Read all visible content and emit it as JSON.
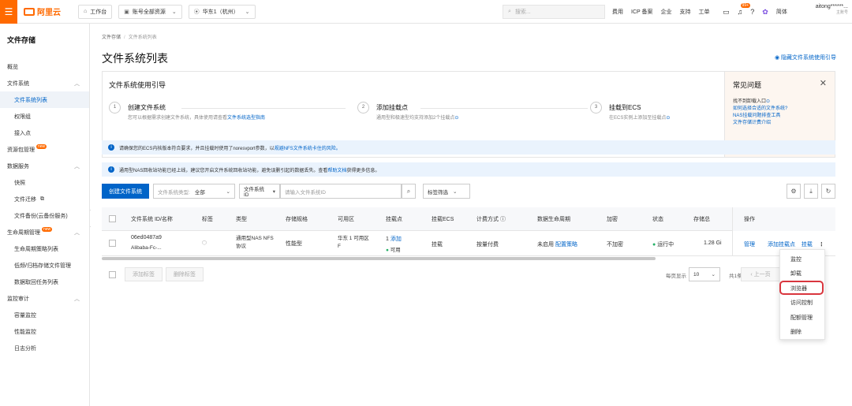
{
  "topbar": {
    "logo": "阿里云",
    "workbench": "工作台",
    "account": "账号全部资源",
    "region": "华东1（杭州）",
    "search_placeholder": "搜索...",
    "links": [
      "费用",
      "ICP 备案",
      "企业",
      "支持",
      "工单"
    ],
    "badge": "99+",
    "lang": "简体",
    "user_name": "aitong******...",
    "user_role": "主账号"
  },
  "sidebar": {
    "title": "文件存储",
    "items": [
      {
        "label": "概览"
      },
      {
        "label": "文件系统"
      },
      {
        "label": "文件系统列表"
      },
      {
        "label": "权限组"
      },
      {
        "label": "接入点"
      },
      {
        "label": "资源包管理",
        "badge": "new"
      },
      {
        "label": "数据服务"
      },
      {
        "label": "快照"
      },
      {
        "label": "文件迁移"
      },
      {
        "label": "文件备份(云备份服务)"
      },
      {
        "label": "生命周期管理",
        "badge": "new"
      },
      {
        "label": "生命周期策略列表"
      },
      {
        "label": "低频/归档存储文件管理"
      },
      {
        "label": "数据取回任务列表"
      },
      {
        "label": "监控审计"
      },
      {
        "label": "容量监控"
      },
      {
        "label": "性能监控"
      },
      {
        "label": "日志分析"
      }
    ]
  },
  "breadcrumb": {
    "root": "文件存储",
    "current": "文件系统列表"
  },
  "page_title": "文件系统列表",
  "hide_guide": "隐藏文件系统使用引导",
  "guide": {
    "title": "文件系统使用引导",
    "steps": [
      {
        "num": "1",
        "title": "创建文件系统",
        "desc": "您可以根据需求创建文件系统，具体使用请查看",
        "link": "文件系统选型指南"
      },
      {
        "num": "2",
        "title": "添加挂载点",
        "desc": "通用型和极速型均支持添加2个挂载点"
      },
      {
        "num": "3",
        "title": "挂载到ECS",
        "desc": "在ECS实例上添加至挂载点"
      }
    ],
    "faq_title": "常见问题",
    "faq": [
      "找不到卸载入口",
      "如何选择合适的文件系统?",
      "NAS挂载问题排查工具",
      "文件存储计费介绍"
    ]
  },
  "notices": [
    {
      "text": "请确保您的ECS内核版本符合要求，并且挂载时使用了noresvport参数，以",
      "link": "规避NFS文件系统卡住的风险。"
    },
    {
      "text": "通用型NAS回收站功能已经上线，建议您开启文件系统回收站功能，避免误删引起的数据丢失。查看",
      "link": "帮助文档",
      "tail": "获得更多信息。"
    }
  ],
  "toolbar": {
    "create_button": "创建文件系统",
    "type_label": "文件系统类型:",
    "type_value": "全部",
    "id_select": "文件系统ID",
    "search_placeholder": "请输入文件系统ID",
    "tag_filter": "标签筛选"
  },
  "table": {
    "headers": [
      "文件系统 ID/名称",
      "标签",
      "类型",
      "存储规格",
      "可用区",
      "挂载点",
      "挂载ECS",
      "计费方式",
      "数据生命周期",
      "加密",
      "状态",
      "存储总",
      "操作"
    ],
    "row": {
      "id": "06ed0487a9",
      "name": "Alibaba-Fc-...",
      "type": "通用型NAS NFS 协议",
      "spec": "性能型",
      "zone": "华东 1 可用区 F",
      "mount_count": "1",
      "mount_add": "添加",
      "mount_status": "可用",
      "mount_ecs": "挂载",
      "billing": "按量付费",
      "lifecycle": "未启用",
      "lifecycle_link": "配置策略",
      "encrypt": "不加密",
      "status": "运行中",
      "storage": "1.28 Gi",
      "ops": [
        "管理",
        "添加挂载点",
        "挂载"
      ]
    }
  },
  "footer": {
    "add_tag": "添加标签",
    "del_tag": "删除标签",
    "per_page_label": "每页显示",
    "per_page": "10",
    "total": "共1条",
    "prev": "上一页"
  },
  "dropdown": {
    "items": [
      "监控",
      "卸载",
      "浏览器",
      "访问控制",
      "配额管理",
      "删除"
    ],
    "highlight_color": "#d9363e"
  },
  "colors": {
    "accent": "#ff6a00",
    "link": "#0064c8",
    "primary": "#0064c8",
    "success": "#23b066"
  }
}
